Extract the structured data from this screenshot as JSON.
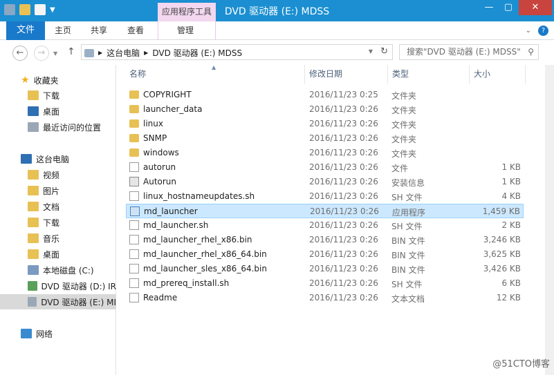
{
  "window": {
    "title": "DVD 驱动器 (E:) MDSS",
    "context_tab_group": "应用程序工具",
    "controls": {
      "minimize": "—",
      "maximize": "▢",
      "close": "✕"
    }
  },
  "ribbon": {
    "tabs": [
      "文件",
      "主页",
      "共享",
      "查看",
      "管理"
    ],
    "help": "?"
  },
  "address": {
    "path": [
      "这台电脑",
      "DVD 驱动器 (E:) MDSS"
    ],
    "search_placeholder": "搜索\"DVD 驱动器 (E:) MDSS\""
  },
  "nav": {
    "favorites": {
      "label": "收藏夹",
      "items": [
        "下载",
        "桌面",
        "最近访问的位置"
      ]
    },
    "pc": {
      "label": "这台电脑",
      "items": [
        "视频",
        "图片",
        "文档",
        "下载",
        "音乐",
        "桌面",
        "本地磁盘 (C:)",
        "DVD 驱动器 (D:) IR",
        "DVD 驱动器 (E:) MI"
      ]
    },
    "network": "网络"
  },
  "columns": [
    "名称",
    "修改日期",
    "类型",
    "大小"
  ],
  "files": [
    {
      "name": "COPYRIGHT",
      "date": "2016/11/23 0:25",
      "type": "文件夹",
      "size": "",
      "icon": "folder"
    },
    {
      "name": "launcher_data",
      "date": "2016/11/23 0:26",
      "type": "文件夹",
      "size": "",
      "icon": "folder"
    },
    {
      "name": "linux",
      "date": "2016/11/23 0:26",
      "type": "文件夹",
      "size": "",
      "icon": "folder"
    },
    {
      "name": "SNMP",
      "date": "2016/11/23 0:26",
      "type": "文件夹",
      "size": "",
      "icon": "folder"
    },
    {
      "name": "windows",
      "date": "2016/11/23 0:26",
      "type": "文件夹",
      "size": "",
      "icon": "folder"
    },
    {
      "name": "autorun",
      "date": "2016/11/23 0:26",
      "type": "文件",
      "size": "1 KB",
      "icon": "file"
    },
    {
      "name": "Autorun",
      "date": "2016/11/23 0:26",
      "type": "安装信息",
      "size": "1 KB",
      "icon": "inf"
    },
    {
      "name": "linux_hostnameupdates.sh",
      "date": "2016/11/23 0:26",
      "type": "SH 文件",
      "size": "4 KB",
      "icon": "file"
    },
    {
      "name": "md_launcher",
      "date": "2016/11/23 0:26",
      "type": "应用程序",
      "size": "1,459 KB",
      "icon": "exe"
    },
    {
      "name": "md_launcher.sh",
      "date": "2016/11/23 0:26",
      "type": "SH 文件",
      "size": "2 KB",
      "icon": "file"
    },
    {
      "name": "md_launcher_rhel_x86.bin",
      "date": "2016/11/23 0:26",
      "type": "BIN 文件",
      "size": "3,246 KB",
      "icon": "file"
    },
    {
      "name": "md_launcher_rhel_x86_64.bin",
      "date": "2016/11/23 0:26",
      "type": "BIN 文件",
      "size": "3,625 KB",
      "icon": "file"
    },
    {
      "name": "md_launcher_sles_x86_64.bin",
      "date": "2016/11/23 0:26",
      "type": "BIN 文件",
      "size": "3,426 KB",
      "icon": "file"
    },
    {
      "name": "md_prereq_install.sh",
      "date": "2016/11/23 0:26",
      "type": "SH 文件",
      "size": "6 KB",
      "icon": "file"
    },
    {
      "name": "Readme",
      "date": "2016/11/23 0:26",
      "type": "文本文档",
      "size": "12 KB",
      "icon": "file"
    }
  ],
  "selected_file": "md_launcher",
  "watermark": "@51CTO博客",
  "colors": {
    "titlebar": "#1b8fd1",
    "file_tab": "#1979ca",
    "context_tab": "#f2d7ef",
    "selection": "#cce8ff"
  }
}
